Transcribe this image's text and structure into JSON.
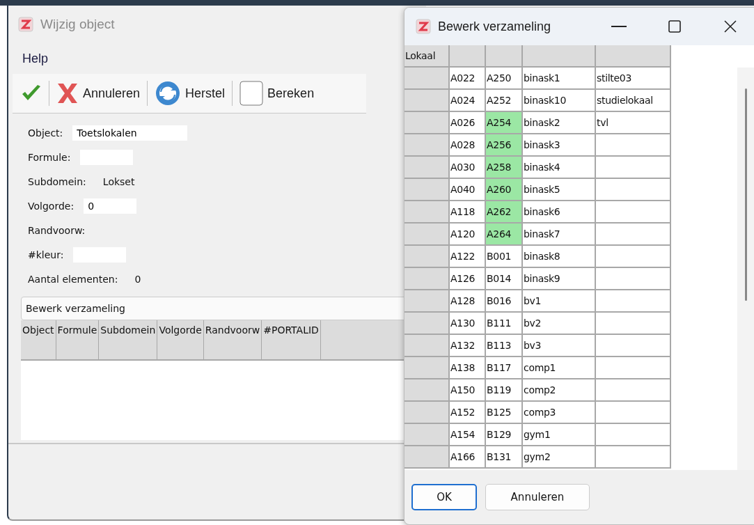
{
  "main_window": {
    "title": "Wijzig object",
    "active": false,
    "menu": [
      "Help"
    ],
    "toolbar": [
      {
        "kind": "check"
      },
      {
        "kind": "cancel",
        "label": "Annuleren"
      },
      {
        "kind": "refresh",
        "label": "Herstel"
      },
      {
        "kind": "checkbox",
        "label": "Bereken",
        "checked": false
      }
    ],
    "fields": [
      {
        "label": "Object:",
        "kind": "input",
        "value": "Toetslokalen"
      },
      {
        "label": "Formule:",
        "kind": "input"
      },
      {
        "label": "Subdomein:",
        "kind": "text",
        "value": "Lokset"
      },
      {
        "label": "Volgorde:",
        "kind": "input",
        "value": "0"
      },
      {
        "label": "Randvoorw:",
        "kind": "text"
      },
      {
        "label": "#kleur:",
        "kind": "input"
      },
      {
        "label": "Aantal elementen:",
        "kind": "text",
        "value": "0"
      }
    ],
    "collection_button": "Bewerk verzameling",
    "table": {
      "columns": [
        "Object",
        "Formule",
        "Subdomein",
        "Volgorde",
        "Randvoorw",
        "#PORTALID"
      ]
    }
  },
  "dialog": {
    "title": "Bewerk verzameling",
    "grid": {
      "corner": "Lokaal",
      "rows": [
        {
          "cells": [
            "A022",
            "A250",
            "binask1",
            "stilte03"
          ],
          "highlighted": false
        },
        {
          "cells": [
            "A024",
            "A252",
            "binask10",
            "studielokaal"
          ],
          "highlighted": false
        },
        {
          "cells": [
            "A026",
            "A254",
            "binask2",
            "tvl"
          ],
          "highlighted": true
        },
        {
          "cells": [
            "A028",
            "A256",
            "binask3"
          ],
          "highlighted": true
        },
        {
          "cells": [
            "A030",
            "A258",
            "binask4"
          ],
          "highlighted": true
        },
        {
          "cells": [
            "A040",
            "A260",
            "binask5"
          ],
          "highlighted": true
        },
        {
          "cells": [
            "A118",
            "A262",
            "binask6"
          ],
          "highlighted": true
        },
        {
          "cells": [
            "A120",
            "A264",
            "binask7"
          ],
          "highlighted": true
        },
        {
          "cells": [
            "A122",
            "B001",
            "binask8"
          ],
          "highlighted": false
        },
        {
          "cells": [
            "A126",
            "B014",
            "binask9"
          ],
          "highlighted": false
        },
        {
          "cells": [
            "A128",
            "B016",
            "bv1"
          ],
          "highlighted": false
        },
        {
          "cells": [
            "A130",
            "B111",
            "bv2"
          ],
          "highlighted": false
        },
        {
          "cells": [
            "A132",
            "B113",
            "bv3"
          ],
          "highlighted": false
        },
        {
          "cells": [
            "A138",
            "B117",
            "comp1"
          ],
          "highlighted": false
        },
        {
          "cells": [
            "A150",
            "B119",
            "comp2"
          ],
          "highlighted": false
        },
        {
          "cells": [
            "A152",
            "B125",
            "comp3"
          ],
          "highlighted": false
        },
        {
          "cells": [
            "A154",
            "B129",
            "gym1"
          ],
          "highlighted": false
        },
        {
          "cells": [
            "A166",
            "B131",
            "gym2"
          ],
          "highlighted": false
        }
      ]
    },
    "buttons": [
      {
        "label": "OK",
        "default": true
      },
      {
        "label": "Annuleren",
        "default": false
      }
    ]
  }
}
